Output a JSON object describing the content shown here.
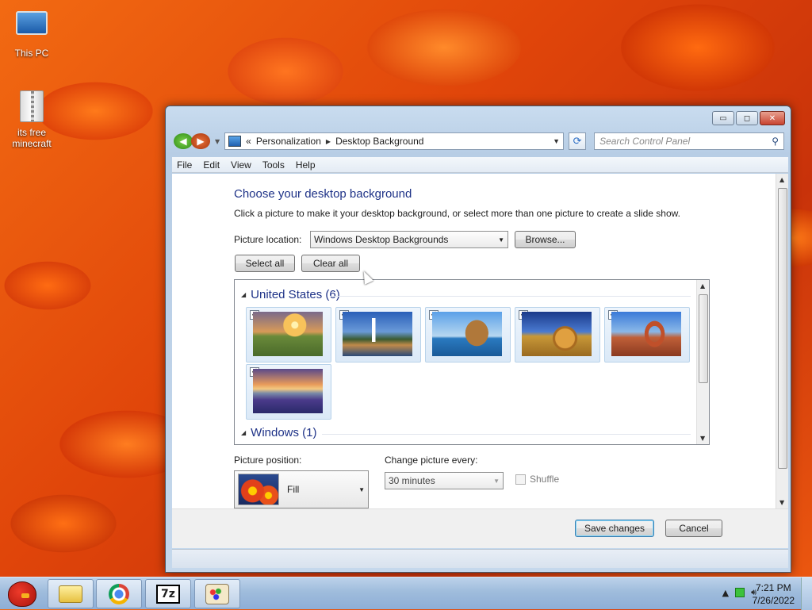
{
  "desktop": {
    "icons": [
      {
        "label": "This PC"
      },
      {
        "label": "its free minecraft"
      }
    ]
  },
  "window": {
    "caption_buttons": {
      "minimize": "▭",
      "maximize": "◻",
      "close": "✕"
    },
    "address": {
      "overflow": "«",
      "crumbs": [
        "Personalization",
        "Desktop Background"
      ]
    },
    "search_placeholder": "Search Control Panel",
    "menu": [
      "File",
      "Edit",
      "View",
      "Tools",
      "Help"
    ]
  },
  "page": {
    "title": "Choose your desktop background",
    "subtitle": "Click a picture to make it your desktop background, or select more than one picture to create a slide show.",
    "picture_location_label": "Picture location:",
    "picture_location_value": "Windows Desktop Backgrounds",
    "browse_label": "Browse...",
    "select_all_label": "Select all",
    "clear_all_label": "Clear all",
    "groups": [
      {
        "name": "United States (6)",
        "items": [
          {
            "name": "sunset-meadow",
            "checked": true
          },
          {
            "name": "lighthouse",
            "checked": true
          },
          {
            "name": "sea-arch",
            "checked": true
          },
          {
            "name": "hay-bale",
            "checked": true
          },
          {
            "name": "delicate-arch",
            "checked": true
          },
          {
            "name": "flower-lake",
            "checked": true
          }
        ]
      },
      {
        "name": "Windows (1)",
        "items": []
      }
    ],
    "picture_position_label": "Picture position:",
    "picture_position_value": "Fill",
    "change_every_label": "Change picture every:",
    "change_every_value": "30 minutes",
    "shuffle_label": "Shuffle",
    "shuffle_checked": false
  },
  "footer": {
    "save_label": "Save changes",
    "cancel_label": "Cancel"
  },
  "taskbar": {
    "clock_time": "7:21 PM",
    "clock_date": "7/26/2022",
    "apps": [
      "file-explorer",
      "chrome",
      "7-zip",
      "paint"
    ]
  }
}
